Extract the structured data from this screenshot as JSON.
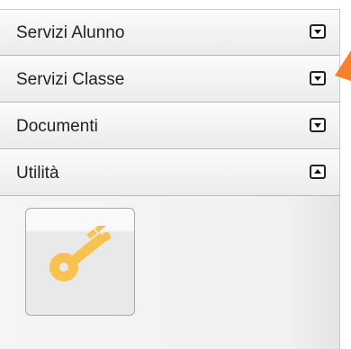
{
  "sections": [
    {
      "label": "Servizi Alunno",
      "state": "collapsed",
      "icon": "expand-arrow-icon"
    },
    {
      "label": "Servizi Classe",
      "state": "collapsed",
      "icon": "expand-arrow-icon"
    },
    {
      "label": "Documenti",
      "state": "collapsed",
      "icon": "expand-arrow-icon"
    },
    {
      "label": "Utilità",
      "state": "expanded",
      "icon": "collapse-arrow-icon"
    }
  ],
  "utilita_panel": {
    "tile_icon": "key-icon"
  },
  "colors": {
    "key": "#f7c24f",
    "cursor": "#f5812c",
    "header_gradient_top": "#fbfbfb",
    "header_gradient_bottom": "#ebebeb"
  }
}
